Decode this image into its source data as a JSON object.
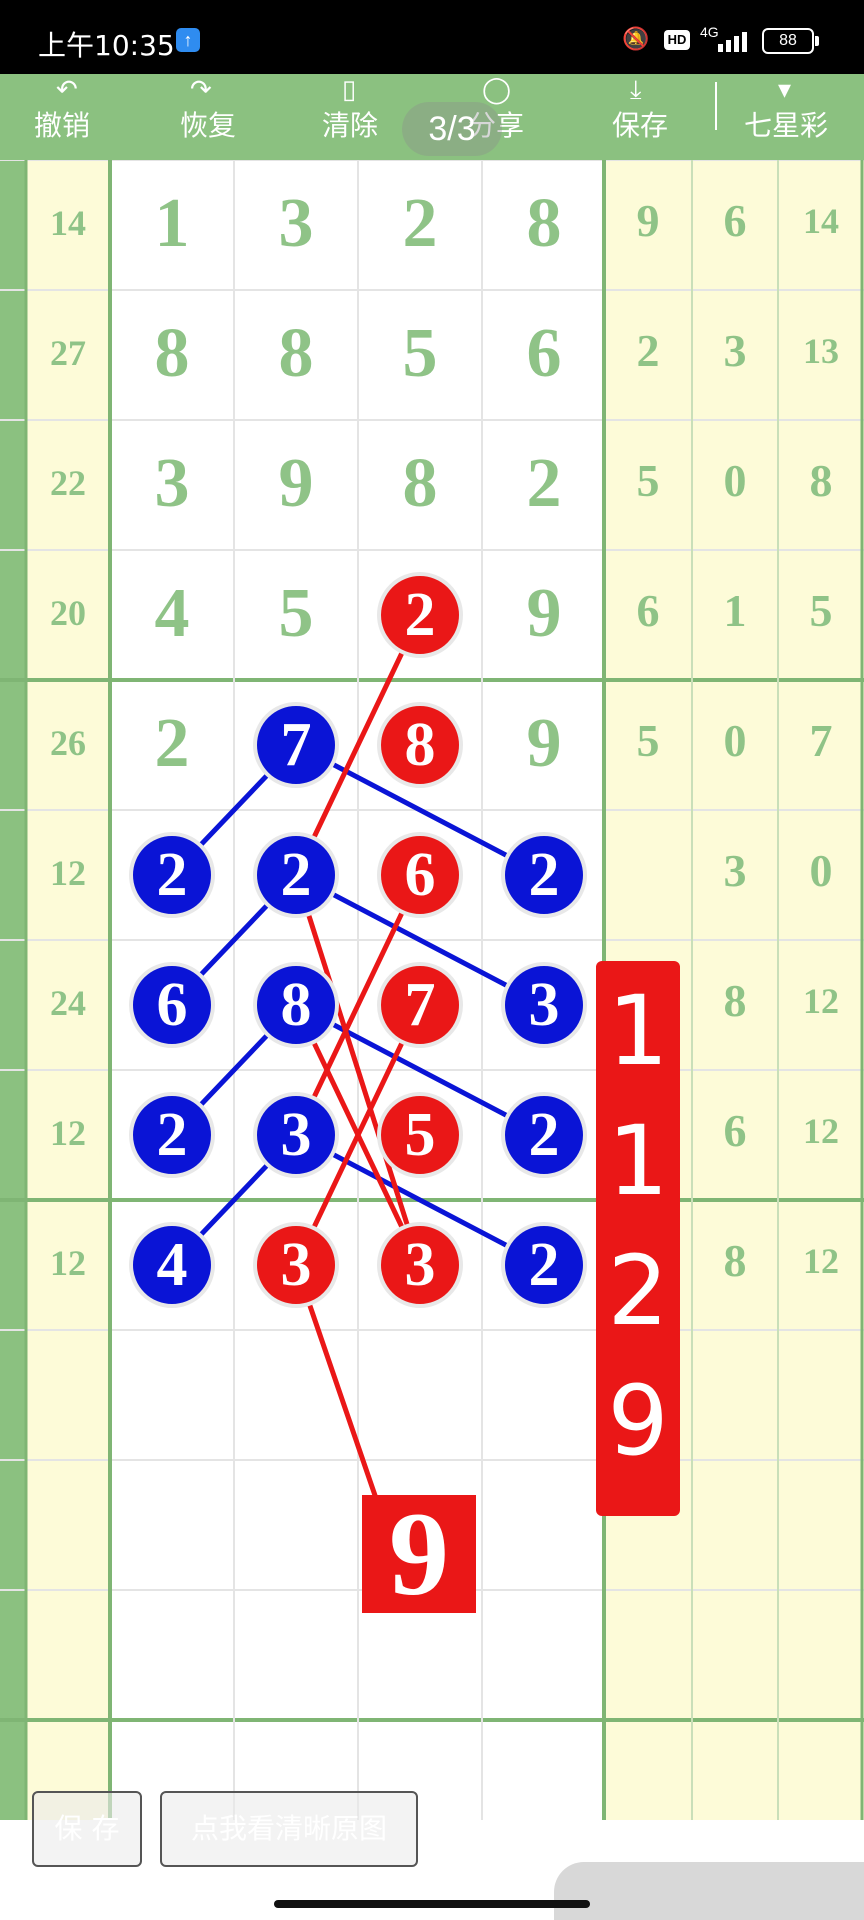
{
  "status_bar": {
    "time": "上午10:35",
    "network": "4G",
    "hd": "HD",
    "battery": "88"
  },
  "toolbar": {
    "undo": "撤销",
    "redo": "恢复",
    "clear": "清除",
    "share": "分享",
    "save": "保存",
    "lottery": "七星彩",
    "pager": "3/3"
  },
  "grid": {
    "left_labels": [
      "14",
      "27",
      "22",
      "20",
      "26",
      "12",
      "24",
      "12",
      "12"
    ],
    "main_rows": [
      [
        "1",
        "3",
        "2",
        "8"
      ],
      [
        "8",
        "8",
        "5",
        "6"
      ],
      [
        "3",
        "9",
        "8",
        "2"
      ],
      [
        "4",
        "5",
        "",
        "9"
      ],
      [
        "2",
        "",
        "",
        "9"
      ]
    ],
    "side_rows": [
      [
        "9",
        "6",
        "14"
      ],
      [
        "2",
        "3",
        "13"
      ],
      [
        "5",
        "0",
        "8"
      ],
      [
        "6",
        "1",
        "5"
      ],
      [
        "5",
        "0",
        "7"
      ],
      [
        "",
        "3",
        "0"
      ],
      [
        "",
        "8",
        "12"
      ],
      [
        "",
        "6",
        "12"
      ],
      [
        "",
        "8",
        "12"
      ]
    ]
  },
  "balls": [
    {
      "row": 3,
      "col": 2,
      "color": "red",
      "value": "2"
    },
    {
      "row": 4,
      "col": 1,
      "color": "blue",
      "value": "7"
    },
    {
      "row": 4,
      "col": 2,
      "color": "red",
      "value": "8"
    },
    {
      "row": 5,
      "col": 0,
      "color": "blue",
      "value": "2"
    },
    {
      "row": 5,
      "col": 1,
      "color": "blue",
      "value": "2"
    },
    {
      "row": 5,
      "col": 2,
      "color": "red",
      "value": "6"
    },
    {
      "row": 5,
      "col": 3,
      "color": "blue",
      "value": "2"
    },
    {
      "row": 6,
      "col": 0,
      "color": "blue",
      "value": "6"
    },
    {
      "row": 6,
      "col": 1,
      "color": "blue",
      "value": "8"
    },
    {
      "row": 6,
      "col": 2,
      "color": "red",
      "value": "7"
    },
    {
      "row": 6,
      "col": 3,
      "color": "blue",
      "value": "3"
    },
    {
      "row": 7,
      "col": 0,
      "color": "blue",
      "value": "2"
    },
    {
      "row": 7,
      "col": 1,
      "color": "blue",
      "value": "3"
    },
    {
      "row": 7,
      "col": 2,
      "color": "red",
      "value": "5"
    },
    {
      "row": 7,
      "col": 3,
      "color": "blue",
      "value": "2"
    },
    {
      "row": 8,
      "col": 0,
      "color": "blue",
      "value": "4"
    },
    {
      "row": 8,
      "col": 1,
      "color": "red",
      "value": "3"
    },
    {
      "row": 8,
      "col": 2,
      "color": "red",
      "value": "3"
    },
    {
      "row": 8,
      "col": 3,
      "color": "blue",
      "value": "2"
    }
  ],
  "sum_digits": [
    "1",
    "1",
    "2",
    "9"
  ],
  "bottom_result": "9",
  "buttons": {
    "save": "保 存",
    "view_original": "点我看清晰原图"
  },
  "colors": {
    "red": "#ea1717",
    "blue": "#0a14d6",
    "green": "#8fc387",
    "pale_yellow": "#fdfbd8"
  }
}
